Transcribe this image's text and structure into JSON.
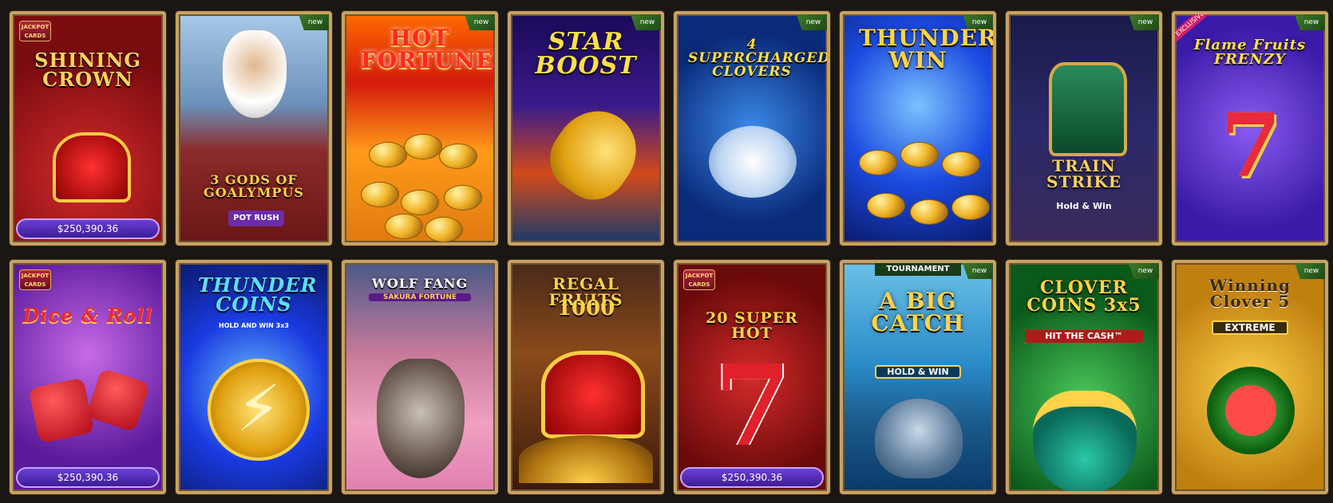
{
  "games": [
    {
      "id": "shining-crown",
      "title": "SHINING CROWN",
      "new": false,
      "jackpot_badge": "JACKPOT CARDS",
      "jackpot_amount": "$250,390.36"
    },
    {
      "id": "3-gods-of-goalympus",
      "title": "3 GODS OF GOALYMPUS",
      "subtitle": "POT RUSH",
      "new": true
    },
    {
      "id": "hot-fortune",
      "title": "HOT FORTUNE",
      "new": true
    },
    {
      "id": "star-boost",
      "title": "STAR BOOST",
      "new": true
    },
    {
      "id": "4-supercharged-clovers",
      "title": "4 SUPERCHARGED CLOVERS",
      "new": true
    },
    {
      "id": "thunder-win",
      "title": "THUNDER WIN",
      "new": true
    },
    {
      "id": "train-strike",
      "title": "TRAIN STRIKE",
      "subtitle": "Hold & Win",
      "new": true
    },
    {
      "id": "flame-fruits-frenzy",
      "title": "Flame Fruits FRENZY",
      "new": true,
      "exclusive": "EXCLUSIVE"
    },
    {
      "id": "dice-and-roll",
      "title": "Dice & Roll",
      "jackpot_badge": "JACKPOT CARDS",
      "jackpot_amount": "$250,390.36"
    },
    {
      "id": "thunder-coins",
      "title": "THUNDER COINS",
      "subtitle": "HOLD AND WIN 3x3"
    },
    {
      "id": "wolf-fang",
      "title": "WOLF FANG",
      "subtitle": "SAKURA FORTUNE"
    },
    {
      "id": "regal-fruits-1000",
      "title": "REGAL FRUITS",
      "subtitle": "1000"
    },
    {
      "id": "20-super-hot",
      "title": "20 SUPER HOT",
      "jackpot_badge": "JACKPOT CARDS",
      "jackpot_amount": "$250,390.36"
    },
    {
      "id": "a-big-catch",
      "title": "A BIG CATCH",
      "subtitle": "HOLD & WIN",
      "tag": "TOURNAMENT",
      "new": true
    },
    {
      "id": "clover-coins",
      "title": "CLOVER COINS 3x5",
      "subtitle": "HIT THE CASH™",
      "new": true
    },
    {
      "id": "winning-clover-5",
      "title": "Winning Clover 5",
      "subtitle": "EXTREME",
      "new": true
    }
  ],
  "labels": {
    "new": "new"
  },
  "colors": {
    "frame": "#c8a264",
    "background": "#1a1613",
    "jackpot_bar": "#5a2fc0"
  }
}
